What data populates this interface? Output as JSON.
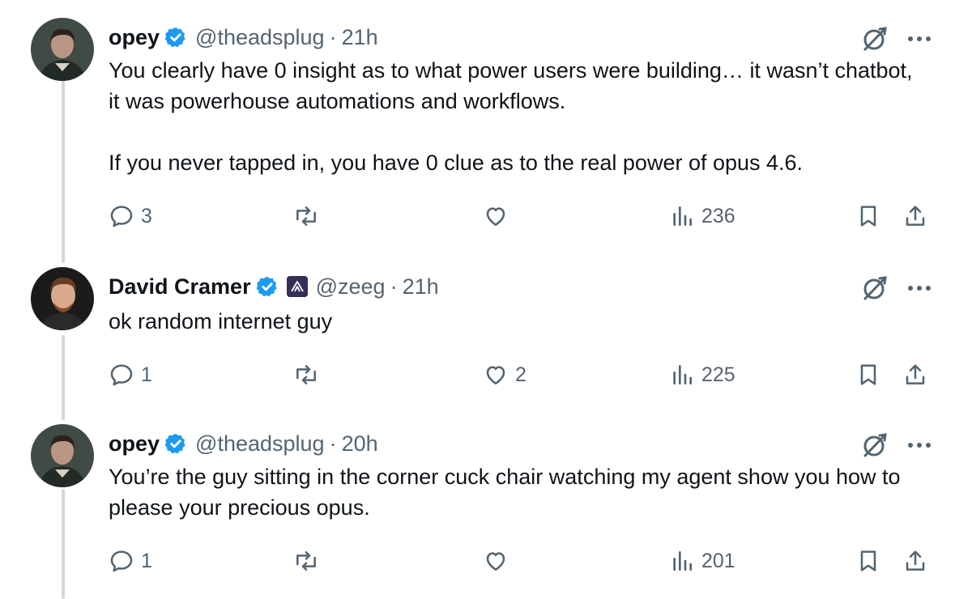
{
  "tweets": [
    {
      "name": "opey",
      "handle": "@theadsplug",
      "time": "21h",
      "text": "You clearly have 0 insight as to what power users were building… it wasn’t chatbot, it was powerhouse automations and workflows.\n\nIf you never tapped in, you have 0 clue as to the real power of opus 4.6.",
      "replies": "3",
      "retweets": "",
      "likes": "",
      "views": "236"
    },
    {
      "name": "David Cramer",
      "handle": "@zeeg",
      "time": "21h",
      "text": "ok random internet guy",
      "replies": "1",
      "retweets": "",
      "likes": "2",
      "views": "225"
    },
    {
      "name": "opey",
      "handle": "@theadsplug",
      "time": "20h",
      "text": "You’re the guy sitting in the corner cuck chair watching my agent show you how to please your precious opus.",
      "replies": "1",
      "retweets": "",
      "likes": "",
      "views": "201"
    }
  ],
  "separator": "·",
  "colors": {
    "verified": "#1d9bf0",
    "muted": "#536471",
    "text": "#0f1419",
    "thread_line": "#cfd9de"
  }
}
